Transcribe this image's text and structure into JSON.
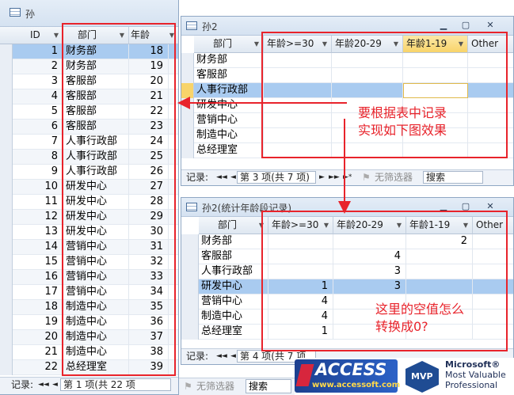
{
  "win1": {
    "title": "孙",
    "headers": {
      "id": "ID",
      "dept": "部门",
      "age": "年龄"
    },
    "rows": [
      {
        "id": "1",
        "dept": "财务部",
        "age": "18"
      },
      {
        "id": "2",
        "dept": "财务部",
        "age": "19"
      },
      {
        "id": "3",
        "dept": "客服部",
        "age": "20"
      },
      {
        "id": "4",
        "dept": "客服部",
        "age": "21"
      },
      {
        "id": "5",
        "dept": "客服部",
        "age": "22"
      },
      {
        "id": "6",
        "dept": "客服部",
        "age": "23"
      },
      {
        "id": "7",
        "dept": "人事行政部",
        "age": "24"
      },
      {
        "id": "8",
        "dept": "人事行政部",
        "age": "25"
      },
      {
        "id": "9",
        "dept": "人事行政部",
        "age": "26"
      },
      {
        "id": "10",
        "dept": "研发中心",
        "age": "27"
      },
      {
        "id": "11",
        "dept": "研发中心",
        "age": "28"
      },
      {
        "id": "12",
        "dept": "研发中心",
        "age": "29"
      },
      {
        "id": "13",
        "dept": "研发中心",
        "age": "30"
      },
      {
        "id": "14",
        "dept": "营销中心",
        "age": "31"
      },
      {
        "id": "15",
        "dept": "营销中心",
        "age": "32"
      },
      {
        "id": "16",
        "dept": "营销中心",
        "age": "33"
      },
      {
        "id": "17",
        "dept": "营销中心",
        "age": "34"
      },
      {
        "id": "18",
        "dept": "制造中心",
        "age": "35"
      },
      {
        "id": "19",
        "dept": "制造中心",
        "age": "36"
      },
      {
        "id": "20",
        "dept": "制造中心",
        "age": "37"
      },
      {
        "id": "21",
        "dept": "制造中心",
        "age": "38"
      },
      {
        "id": "22",
        "dept": "总经理室",
        "age": "39"
      }
    ],
    "nav": {
      "label": "记录:",
      "first": "◄◄",
      "prev": "◄",
      "record": "第 1 项(共 22 项",
      "filter": "无筛选器",
      "search": "搜索"
    }
  },
  "win2": {
    "title": "孙2",
    "headers": {
      "dept": "部门",
      "c1": "年龄>=30",
      "c2": "年龄20-29",
      "c3": "年龄1-19",
      "c4": "Other"
    },
    "rows": [
      {
        "dept": "财务部"
      },
      {
        "dept": "客服部"
      },
      {
        "dept": "人事行政部"
      },
      {
        "dept": "研发中心"
      },
      {
        "dept": "营销中心"
      },
      {
        "dept": "制造中心"
      },
      {
        "dept": "总经理室"
      }
    ],
    "nav": {
      "label": "记录:",
      "first": "◄◄",
      "prev": "◄",
      "record": "第 3 项(共 7 项)",
      "next": "►",
      "last": "►►",
      "new": "►*",
      "filter": "无筛选器",
      "search": "搜索"
    },
    "note": [
      "要根据表中记录",
      "实现如下图效果"
    ]
  },
  "win3": {
    "title": "孙2(统计年龄段记录)",
    "headers": {
      "dept": "部门",
      "c1": "年龄>=30",
      "c2": "年龄20-29",
      "c3": "年龄1-19",
      "c4": "Other"
    },
    "rows": [
      {
        "dept": "财务部",
        "c1": "",
        "c2": "",
        "c3": "2"
      },
      {
        "dept": "客服部",
        "c1": "",
        "c2": "4",
        "c3": ""
      },
      {
        "dept": "人事行政部",
        "c1": "",
        "c2": "3",
        "c3": ""
      },
      {
        "dept": "研发中心",
        "c1": "1",
        "c2": "3",
        "c3": ""
      },
      {
        "dept": "营销中心",
        "c1": "4",
        "c2": "",
        "c3": ""
      },
      {
        "dept": "制造中心",
        "c1": "4",
        "c2": "",
        "c3": ""
      },
      {
        "dept": "总经理室",
        "c1": "1",
        "c2": "",
        "c3": ""
      }
    ],
    "nav": {
      "label": "记录:",
      "first": "◄◄",
      "prev": "◄",
      "record": "第 4 项(共 7 项"
    },
    "note": [
      "这里的空值怎么",
      "转换成0?"
    ]
  },
  "logo": {
    "access": "ACCESS",
    "url": "www.accessoft.com",
    "mvp": "MVP",
    "ms1": "Microsoft®",
    "ms2": "Most Valuable",
    "ms3": "Professional"
  },
  "colors": {
    "highlight": "#a9cbf0",
    "annotation": "#e8232b",
    "header_selected": "#f8d46a"
  }
}
